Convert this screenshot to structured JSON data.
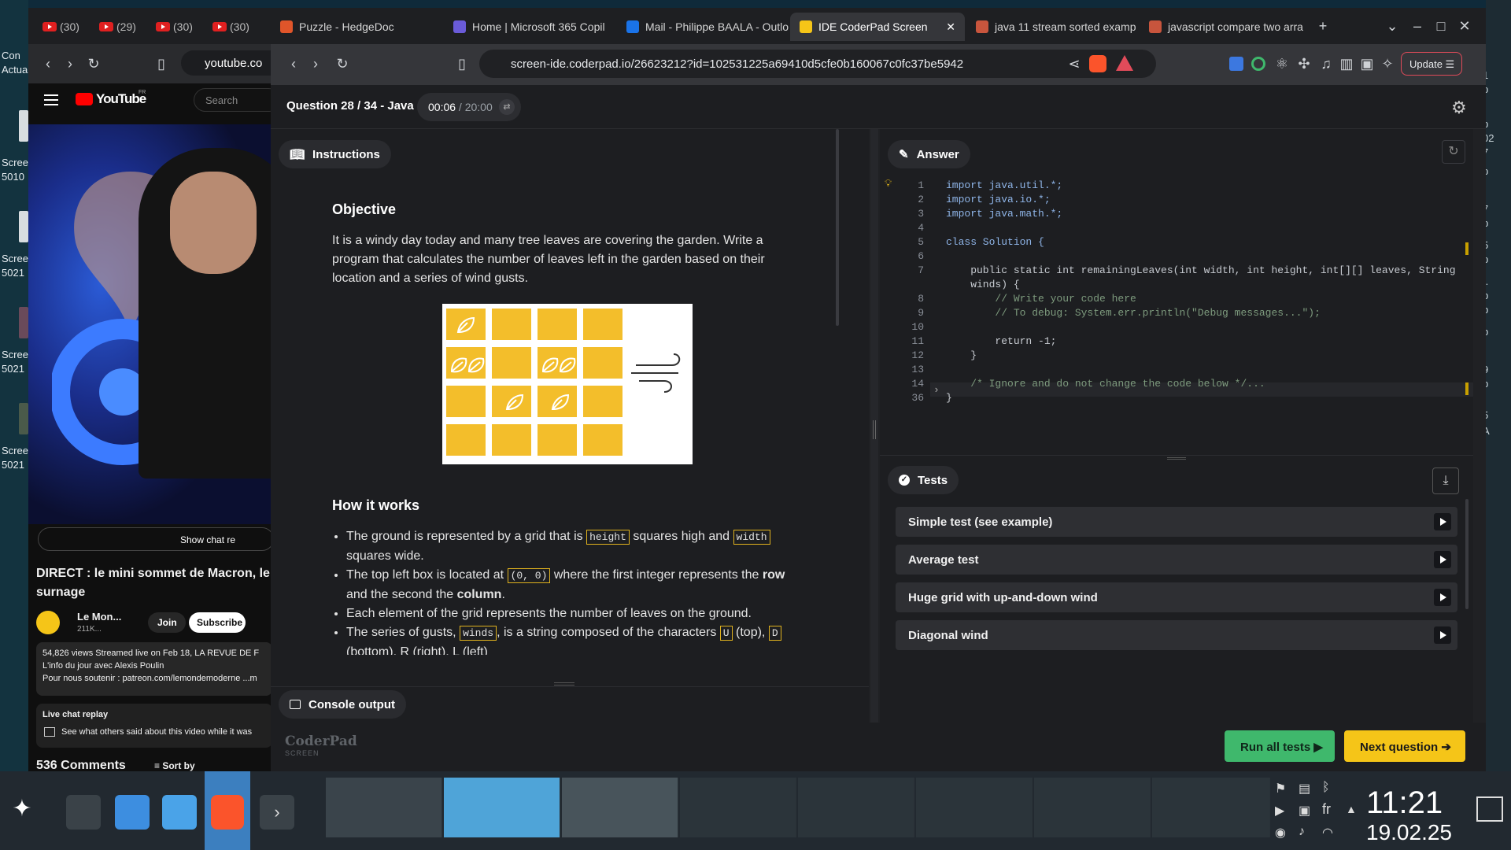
{
  "desktop": {
    "icons": [
      {
        "label": "Con",
        "label2": "Actua"
      },
      {
        "label": "Scree",
        "label2": "5010"
      },
      {
        "label": "Scree",
        "label2": "5021"
      },
      {
        "label": "Scree",
        "label2": "5021"
      },
      {
        "label": "Scree",
        "label2": "5021"
      }
    ],
    "right_chars": [
      "1",
      "p",
      "p",
      "02",
      "7",
      "p",
      "7",
      "p",
      "5",
      "p",
      "f.",
      "b",
      "b",
      "b",
      "9",
      "p",
      "5",
      "A"
    ]
  },
  "youtube": {
    "tabs": [
      "(30)",
      "(29)",
      "(30)",
      "(30)"
    ],
    "url": "youtube.co",
    "brand": "YouTube",
    "brand_sup": "FR",
    "search_placeholder": "Search",
    "show_chat": "Show chat re",
    "video_title": "DIRECT : le mini sommet de Macron, le l",
    "video_title2": "surnage",
    "channel": "Le Mon...",
    "subs": "211K...",
    "join": "Join",
    "subscribe": "Subscribe",
    "desc_meta": "54,826 views  Streamed live on Feb 18,   LA REVUE DE F",
    "desc_line2": "L'info du jour avec Alexis Poulin",
    "desc_line3": "Pour nous soutenir : patreon.com/lemondemoderne ...m",
    "live_chat": "Live chat replay",
    "live_chat_desc": "See what others said about this video while it was",
    "comments": "536 Comments",
    "sort": "Sort by"
  },
  "browser": {
    "tabs": [
      {
        "label": "Puzzle - HedgeDoc",
        "color": "#e0552a"
      },
      {
        "label": "Home | Microsoft 365 Copil",
        "color": "#6a5bd8"
      },
      {
        "label": "Mail - Philippe BAALA - Outlo",
        "color": "#1a73e8"
      },
      {
        "label": "IDE CoderPad Screen",
        "color": "#f5c518",
        "active": true
      },
      {
        "label": "java 11 stream sorted examp",
        "color": "#c8553d"
      },
      {
        "label": "javascript compare two arra",
        "color": "#c8553d"
      }
    ],
    "url": "screen-ide.coderpad.io/26623212?id=102531225a69410d5cfe0b160067c0fc37be5942",
    "update": "Update"
  },
  "coderpad": {
    "question": "Question 28 / 34 - Java",
    "time_elapsed": "00:06",
    "time_total": " / 20:00",
    "instructions_tab": "Instructions",
    "objective_title": "Objective",
    "objective_text": "It is a windy day today and many tree leaves are covering the garden. Write a program that calculates the number of leaves left in the garden based on their location and a series of wind gusts.",
    "how_title": "How it works",
    "bullets": {
      "b1_a": "The ground is represented by a grid that is ",
      "b1_code1": "height",
      "b1_b": " squares high and ",
      "b1_code2": "width",
      "b1_c": " squares wide.",
      "b2_a": "The top left box is located at ",
      "b2_code": "(0, 0)",
      "b2_b": " where the first integer represents the ",
      "b2_row": "row",
      "b2_c": " and the second the ",
      "b2_col": "column",
      "b2_d": ".",
      "b3": "Each element of the grid represents the number of leaves on the ground.",
      "b4_a": "The series of gusts, ",
      "b4_code": "winds",
      "b4_b": ", is a string composed of the characters ",
      "b4_u": "U",
      "b4_c": " (top), ",
      "b4_d": "D",
      "b5": "(bottom), R (right), L (left)"
    },
    "console": "Console output",
    "answer_tab": "Answer",
    "code_lines": [
      {
        "n": "1",
        "t": "import java.util.*;"
      },
      {
        "n": "2",
        "t": "import java.io.*;"
      },
      {
        "n": "3",
        "t": "import java.math.*;"
      },
      {
        "n": "4",
        "t": ""
      },
      {
        "n": "5",
        "t": "class Solution {"
      },
      {
        "n": "6",
        "t": ""
      },
      {
        "n": "7",
        "t": "    public static int remainingLeaves(int width, int height, int[][] leaves, String"
      },
      {
        "n": "",
        "t": "    winds) {"
      },
      {
        "n": "8",
        "t": "        // Write your code here"
      },
      {
        "n": "9",
        "t": "        // To debug: System.err.println(\"Debug messages...\");"
      },
      {
        "n": "10",
        "t": ""
      },
      {
        "n": "11",
        "t": "        return -1;"
      },
      {
        "n": "12",
        "t": "    }"
      },
      {
        "n": "13",
        "t": ""
      },
      {
        "n": "14",
        "t": "    /* Ignore and do not change the code below */..."
      },
      {
        "n": "36",
        "t": "}"
      }
    ],
    "tests_tab": "Tests",
    "tests": [
      "Simple test (see example)",
      "Average test",
      "Huge grid with up-and-down wind",
      "Diagonal wind"
    ],
    "brand": "CoderPad",
    "brand_sub": "SCREEN",
    "run_all": "Run all tests",
    "next": "Next question"
  },
  "taskbar": {
    "lang": "fr",
    "time": "11:21",
    "date": "19.02.25"
  },
  "colors": {
    "accent_green": "#3fb86c",
    "accent_yellow": "#f5c518",
    "leaf_yellow": "#f3be2b"
  }
}
